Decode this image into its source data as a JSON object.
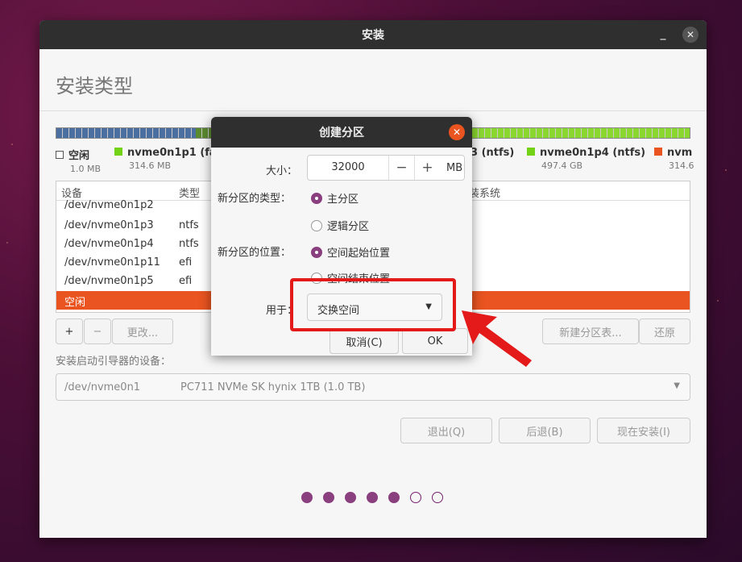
{
  "window": {
    "title": "安装"
  },
  "page": {
    "title": "安装类型"
  },
  "partition_bar": {
    "segments": [
      {
        "color": "#4a6fa0",
        "width": 22
      },
      {
        "color": "#5b8a2f",
        "width": 8
      },
      {
        "color": "#8ad72f",
        "width": 70
      }
    ]
  },
  "legend": [
    {
      "name": "空闲",
      "size": "1.0 MB",
      "color": "#ffffff"
    },
    {
      "name": "nvme0n1p1 (fa",
      "size": "314.6 MB",
      "color": "#73d216"
    },
    {
      "name": "3 (ntfs)",
      "size": "",
      "color": ""
    },
    {
      "name": "nvme0n1p4 (ntfs)",
      "size": "497.4 GB",
      "color": "#73d216"
    },
    {
      "name": "nvm",
      "size": "314.6",
      "color": "#e95420"
    }
  ],
  "table": {
    "headers": [
      "设备",
      "类型",
      "装系统"
    ],
    "rows": [
      {
        "device": "/dev/nvme0n1p2",
        "type": ""
      },
      {
        "device": "/dev/nvme0n1p3",
        "type": "ntfs"
      },
      {
        "device": "/dev/nvme0n1p4",
        "type": "ntfs"
      },
      {
        "device": "/dev/nvme0n1p11",
        "type": "efi"
      },
      {
        "device": "/dev/nvme0n1p5",
        "type": "efi"
      },
      {
        "device": "空闲",
        "type": ""
      }
    ]
  },
  "actions": {
    "add": "+",
    "remove": "−",
    "change": "更改...",
    "new_table": "新建分区表...",
    "revert": "还原"
  },
  "boot": {
    "label": "安装启动引导器的设备：",
    "device": "/dev/nvme0n1",
    "description": "PC711 NVMe SK hynix 1TB (1.0 TB)"
  },
  "nav": {
    "quit": "退出(Q)",
    "back": "后退(B)",
    "install": "现在安装(I)"
  },
  "progress": {
    "total": 7,
    "done": 5
  },
  "dialog": {
    "title": "创建分区",
    "size_label": "大小：",
    "size_value": "32000",
    "minus": "−",
    "plus": "+",
    "unit": "MB",
    "type_label": "新分区的类型：",
    "type_primary": "主分区",
    "type_logical": "逻辑分区",
    "location_label": "新分区的位置：",
    "location_start": "空间起始位置",
    "location_end": "空间结束位置",
    "use_label": "用于：",
    "use_value": "交换空间",
    "cancel": "取消(C)",
    "ok": "OK"
  }
}
